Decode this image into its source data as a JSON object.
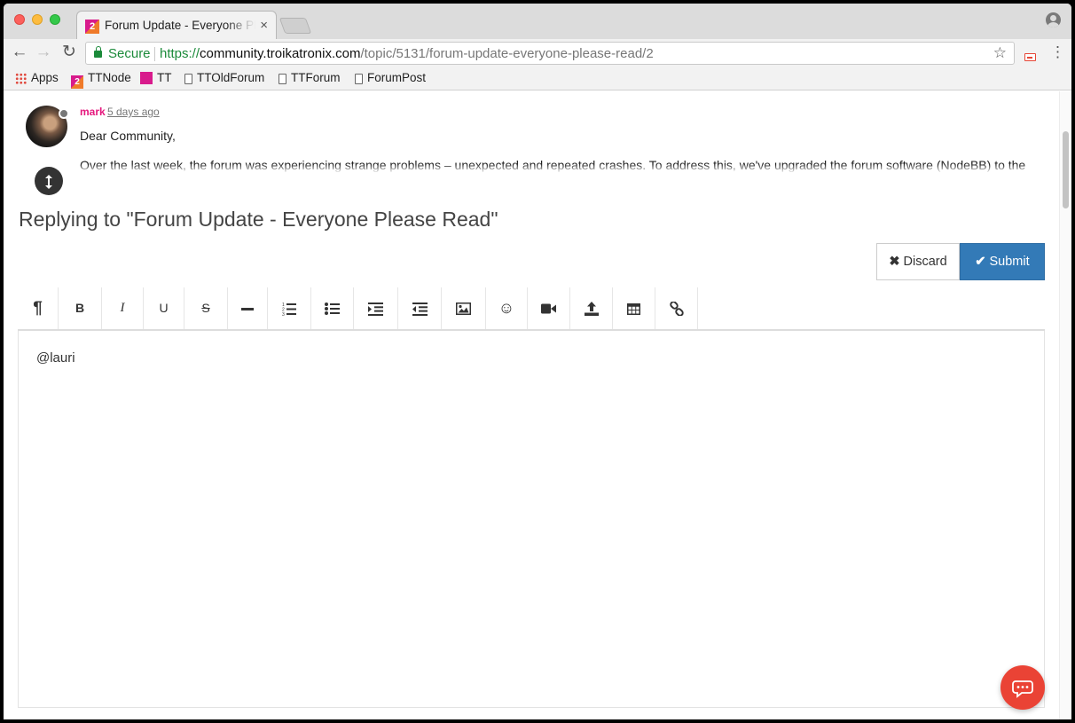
{
  "browser": {
    "tab_title": "Forum Update - Everyone Please Read",
    "tab_favicon_text": "2",
    "tab_close": "×",
    "url": {
      "security_label": "Secure",
      "scheme": "https://",
      "host": "community.troikatronix.com",
      "path": "/topic/5131/forum-update-everyone-please-read/2"
    },
    "nav": {
      "back": "←",
      "forward": "→",
      "reload": "↻"
    },
    "star": "☆",
    "menu": "⋮"
  },
  "bookmarks": [
    {
      "label": "Apps",
      "icon": "apps-grid-icon"
    },
    {
      "label": "TTNode",
      "icon": "troikatronix-favicon-icon"
    },
    {
      "label": "TT",
      "icon": "pink-square-icon"
    },
    {
      "label": "TTOldForum",
      "icon": "page-icon"
    },
    {
      "label": "TTForum",
      "icon": "page-icon"
    },
    {
      "label": "ForumPost",
      "icon": "page-icon"
    }
  ],
  "post": {
    "author": "mark",
    "time": "5 days ago",
    "greeting": "Dear Community,",
    "body": "Over the last week, the forum was experiencing strange problems – unexpected and repeated crashes. To address this, we've upgraded the forum software (NodeBB) to the"
  },
  "composer": {
    "title": "Replying to \"Forum Update - Everyone Please Read\"",
    "discard_label": "Discard",
    "submit_label": "Submit",
    "discard_icon": "✖",
    "submit_icon": "✔",
    "content": "@lauri",
    "toolbar": [
      {
        "name": "paragraph-icon",
        "glyph": "¶"
      },
      {
        "name": "bold-icon",
        "glyph": "B"
      },
      {
        "name": "italic-icon",
        "glyph": "I"
      },
      {
        "name": "underline-icon",
        "glyph": "U"
      },
      {
        "name": "strikethrough-icon",
        "glyph": "S"
      },
      {
        "name": "horizontal-rule-icon",
        "glyph": ""
      },
      {
        "name": "ordered-list-icon",
        "glyph": ""
      },
      {
        "name": "unordered-list-icon",
        "glyph": ""
      },
      {
        "name": "indent-icon",
        "glyph": ""
      },
      {
        "name": "outdent-icon",
        "glyph": ""
      },
      {
        "name": "image-icon",
        "glyph": ""
      },
      {
        "name": "emoji-icon",
        "glyph": "☺"
      },
      {
        "name": "video-icon",
        "glyph": ""
      },
      {
        "name": "upload-icon",
        "glyph": ""
      },
      {
        "name": "table-icon",
        "glyph": ""
      },
      {
        "name": "link-icon",
        "glyph": ""
      }
    ]
  },
  "colors": {
    "accent_pink": "#e5187d",
    "submit_blue": "#337ab7",
    "chat_red": "#ea4335",
    "secure_green": "#1b8a3a"
  }
}
